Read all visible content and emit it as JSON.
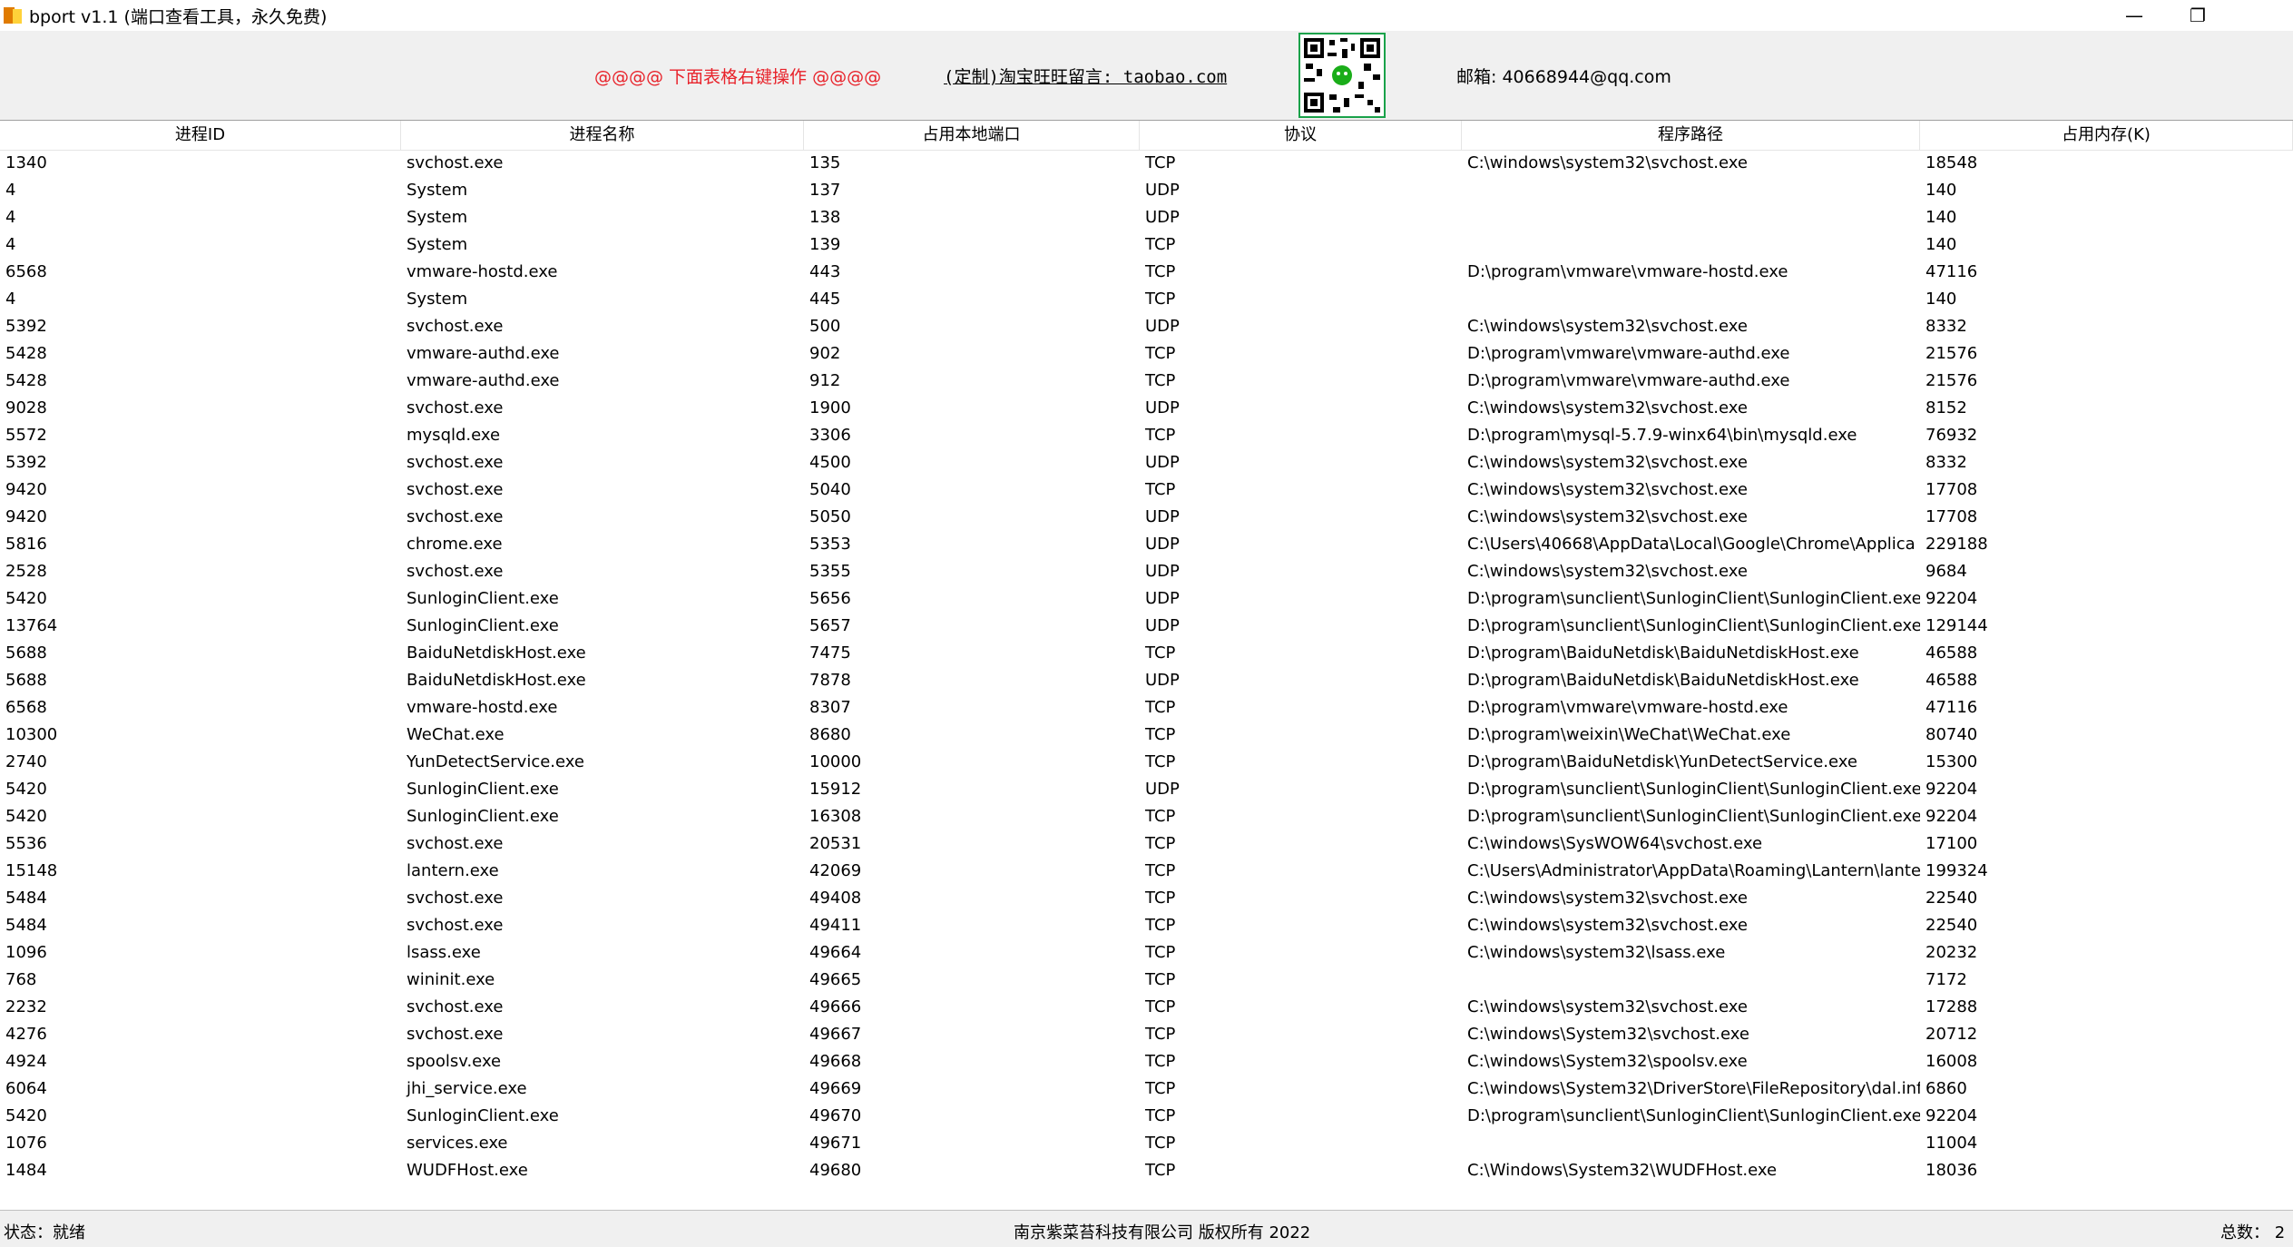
{
  "window": {
    "title": "bport v1.1 (端口查看工具，永久免费)",
    "minimize_glyph": "—",
    "maximize_glyph": "❐"
  },
  "header": {
    "hint": "@@@@ 下面表格右键操作 @@@@",
    "shop": "(定制)淘宝旺旺留言: taobao.com",
    "email": "邮箱: 40668944@qq.com",
    "qr_icon": "wechat-qr-code"
  },
  "table": {
    "columns": [
      "进程ID",
      "进程名称",
      "占用本地端口",
      "协议",
      "程序路径",
      "占用内存(K)"
    ],
    "rows": [
      [
        "1340",
        "svchost.exe",
        "135",
        "TCP",
        "C:\\windows\\system32\\svchost.exe",
        "18548"
      ],
      [
        "4",
        "System",
        "137",
        "UDP",
        "",
        "140"
      ],
      [
        "4",
        "System",
        "138",
        "UDP",
        "",
        "140"
      ],
      [
        "4",
        "System",
        "139",
        "TCP",
        "",
        "140"
      ],
      [
        "6568",
        "vmware-hostd.exe",
        "443",
        "TCP",
        "D:\\program\\vmware\\vmware-hostd.exe",
        "47116"
      ],
      [
        "4",
        "System",
        "445",
        "TCP",
        "",
        "140"
      ],
      [
        "5392",
        "svchost.exe",
        "500",
        "UDP",
        "C:\\windows\\system32\\svchost.exe",
        "8332"
      ],
      [
        "5428",
        "vmware-authd.exe",
        "902",
        "TCP",
        "D:\\program\\vmware\\vmware-authd.exe",
        "21576"
      ],
      [
        "5428",
        "vmware-authd.exe",
        "912",
        "TCP",
        "D:\\program\\vmware\\vmware-authd.exe",
        "21576"
      ],
      [
        "9028",
        "svchost.exe",
        "1900",
        "UDP",
        "C:\\windows\\system32\\svchost.exe",
        "8152"
      ],
      [
        "5572",
        "mysqld.exe",
        "3306",
        "TCP",
        "D:\\program\\mysql-5.7.9-winx64\\bin\\mysqld.exe",
        "76932"
      ],
      [
        "5392",
        "svchost.exe",
        "4500",
        "UDP",
        "C:\\windows\\system32\\svchost.exe",
        "8332"
      ],
      [
        "9420",
        "svchost.exe",
        "5040",
        "TCP",
        "C:\\windows\\system32\\svchost.exe",
        "17708"
      ],
      [
        "9420",
        "svchost.exe",
        "5050",
        "UDP",
        "C:\\windows\\system32\\svchost.exe",
        "17708"
      ],
      [
        "5816",
        "chrome.exe",
        "5353",
        "UDP",
        "C:\\Users\\40668\\AppData\\Local\\Google\\Chrome\\Applica",
        "229188"
      ],
      [
        "2528",
        "svchost.exe",
        "5355",
        "UDP",
        "C:\\windows\\system32\\svchost.exe",
        "9684"
      ],
      [
        "5420",
        "SunloginClient.exe",
        "5656",
        "UDP",
        "D:\\program\\sunclient\\SunloginClient\\SunloginClient.exe",
        "92204"
      ],
      [
        "13764",
        "SunloginClient.exe",
        "5657",
        "UDP",
        "D:\\program\\sunclient\\SunloginClient\\SunloginClient.exe",
        "129144"
      ],
      [
        "5688",
        "BaiduNetdiskHost.exe",
        "7475",
        "TCP",
        "D:\\program\\BaiduNetdisk\\BaiduNetdiskHost.exe",
        "46588"
      ],
      [
        "5688",
        "BaiduNetdiskHost.exe",
        "7878",
        "UDP",
        "D:\\program\\BaiduNetdisk\\BaiduNetdiskHost.exe",
        "46588"
      ],
      [
        "6568",
        "vmware-hostd.exe",
        "8307",
        "TCP",
        "D:\\program\\vmware\\vmware-hostd.exe",
        "47116"
      ],
      [
        "10300",
        "WeChat.exe",
        "8680",
        "TCP",
        "D:\\program\\weixin\\WeChat\\WeChat.exe",
        "80740"
      ],
      [
        "2740",
        "YunDetectService.exe",
        "10000",
        "TCP",
        "D:\\program\\BaiduNetdisk\\YunDetectService.exe",
        "15300"
      ],
      [
        "5420",
        "SunloginClient.exe",
        "15912",
        "UDP",
        "D:\\program\\sunclient\\SunloginClient\\SunloginClient.exe",
        "92204"
      ],
      [
        "5420",
        "SunloginClient.exe",
        "16308",
        "TCP",
        "D:\\program\\sunclient\\SunloginClient\\SunloginClient.exe",
        "92204"
      ],
      [
        "5536",
        "svchost.exe",
        "20531",
        "TCP",
        "C:\\windows\\SysWOW64\\svchost.exe",
        "17100"
      ],
      [
        "15148",
        "lantern.exe",
        "42069",
        "TCP",
        "C:\\Users\\Administrator\\AppData\\Roaming\\Lantern\\lante",
        "199324"
      ],
      [
        "5484",
        "svchost.exe",
        "49408",
        "TCP",
        "C:\\windows\\system32\\svchost.exe",
        "22540"
      ],
      [
        "5484",
        "svchost.exe",
        "49411",
        "TCP",
        "C:\\windows\\system32\\svchost.exe",
        "22540"
      ],
      [
        "1096",
        "lsass.exe",
        "49664",
        "TCP",
        "C:\\windows\\system32\\lsass.exe",
        "20232"
      ],
      [
        "768",
        "wininit.exe",
        "49665",
        "TCP",
        "",
        "7172"
      ],
      [
        "2232",
        "svchost.exe",
        "49666",
        "TCP",
        "C:\\windows\\system32\\svchost.exe",
        "17288"
      ],
      [
        "4276",
        "svchost.exe",
        "49667",
        "TCP",
        "C:\\windows\\System32\\svchost.exe",
        "20712"
      ],
      [
        "4924",
        "spoolsv.exe",
        "49668",
        "TCP",
        "C:\\windows\\System32\\spoolsv.exe",
        "16008"
      ],
      [
        "6064",
        "jhi_service.exe",
        "49669",
        "TCP",
        "C:\\windows\\System32\\DriverStore\\FileRepository\\dal.inf_",
        "6860"
      ],
      [
        "5420",
        "SunloginClient.exe",
        "49670",
        "TCP",
        "D:\\program\\sunclient\\SunloginClient\\SunloginClient.exe",
        "92204"
      ],
      [
        "1076",
        "services.exe",
        "49671",
        "TCP",
        "",
        "11004"
      ],
      [
        "1484",
        "WUDFHost.exe",
        "49680",
        "TCP",
        "C:\\Windows\\System32\\WUDFHost.exe",
        "18036"
      ]
    ]
  },
  "status": {
    "left": "状态：就绪",
    "center": "南京紫菜苔科技有限公司 版权所有 2022",
    "right": "总数： 2"
  }
}
